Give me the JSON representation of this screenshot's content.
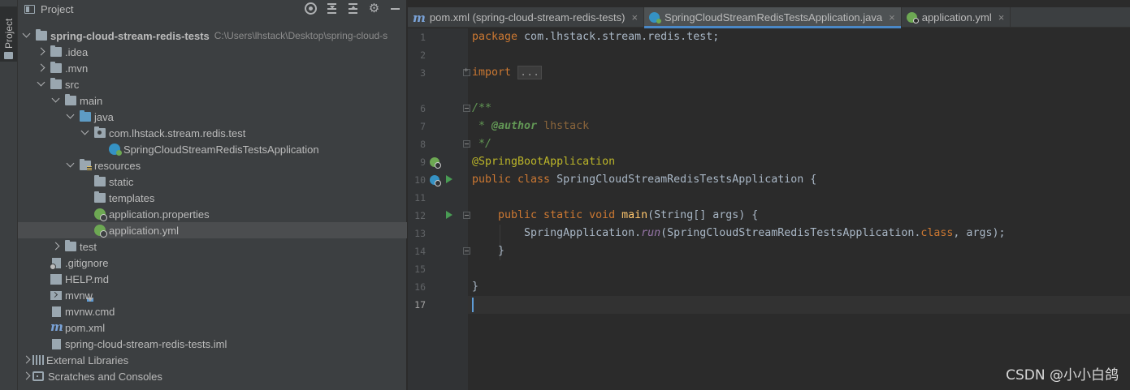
{
  "toolstrip": {
    "project_tab": "Project"
  },
  "project": {
    "title": "Project",
    "header_icons": [
      "locate-icon",
      "expand-all-icon",
      "collapse-all-icon",
      "gear-icon",
      "hide-icon"
    ],
    "tree": [
      {
        "label": "spring-cloud-stream-redis-tests",
        "path": "C:\\Users\\lhstack\\Desktop\\spring-cloud-s",
        "icon": "module-folder-icon",
        "expanded": true
      },
      {
        "label": ".idea",
        "icon": "folder-icon",
        "expanded": false
      },
      {
        "label": ".mvn",
        "icon": "folder-icon",
        "expanded": false
      },
      {
        "label": "src",
        "icon": "folder-icon",
        "expanded": true
      },
      {
        "label": "main",
        "icon": "folder-icon",
        "expanded": true
      },
      {
        "label": "java",
        "icon": "source-folder-icon",
        "expanded": true
      },
      {
        "label": "com.lhstack.stream.redis.test",
        "icon": "package-icon",
        "expanded": true
      },
      {
        "label": "SpringCloudStreamRedisTestsApplication",
        "icon": "spring-boot-class-icon"
      },
      {
        "label": "resources",
        "icon": "resources-folder-icon",
        "expanded": true
      },
      {
        "label": "static",
        "icon": "folder-icon"
      },
      {
        "label": "templates",
        "icon": "folder-icon"
      },
      {
        "label": "application.properties",
        "icon": "spring-config-icon"
      },
      {
        "label": "application.yml",
        "icon": "spring-config-icon",
        "selected": true
      },
      {
        "label": "test",
        "icon": "folder-icon",
        "expanded": false
      },
      {
        "label": ".gitignore",
        "icon": "gitignore-file-icon"
      },
      {
        "label": "HELP.md",
        "icon": "markdown-file-icon"
      },
      {
        "label": "mvnw",
        "icon": "shell-file-icon"
      },
      {
        "label": "mvnw.cmd",
        "icon": "cmd-file-icon"
      },
      {
        "label": "pom.xml",
        "icon": "maven-icon"
      },
      {
        "label": "spring-cloud-stream-redis-tests.iml",
        "icon": "iml-file-icon"
      },
      {
        "label": "External Libraries",
        "icon": "libraries-icon",
        "expanded": false
      },
      {
        "label": "Scratches and Consoles",
        "icon": "scratches-icon",
        "expanded": false
      }
    ]
  },
  "editor": {
    "tabs": [
      {
        "label": "pom.xml (spring-cloud-stream-redis-tests)",
        "icon": "maven-icon",
        "close": "×"
      },
      {
        "label": "SpringCloudStreamRedisTestsApplication.java",
        "icon": "spring-boot-class-icon",
        "close": "×",
        "active": true
      },
      {
        "label": "application.yml",
        "icon": "spring-config-icon",
        "close": "×"
      }
    ],
    "line_numbers": [
      "1",
      "2",
      "3",
      "6",
      "7",
      "8",
      "9",
      "10",
      "11",
      "12",
      "13",
      "14",
      "15",
      "16",
      "17"
    ],
    "code": {
      "l1_kw": "package",
      "l1_rest": " com.lhstack.stream.redis.test;",
      "l3_kw": "import",
      "l3_fold": "...",
      "l6": "/**",
      "l7_star": " * ",
      "l7_tag": "@author",
      "l7_txt": " lhstack",
      "l8": " */",
      "l9": "@SpringBootApplication",
      "l10_kw": "public class",
      "l10_name": " SpringCloudStreamRedisTestsApplication {",
      "l12_kw": "    public static void",
      "l12_fn": " main",
      "l12_rest": "(String[] args) {",
      "l13_cls": "        SpringApplication.",
      "l13_fn": "run",
      "l13_mid": "(SpringCloudStreamRedisTestsApplication.",
      "l13_kw": "class",
      "l13_end": ", args);",
      "l14": "    }",
      "l16": "}"
    }
  },
  "watermark": "CSDN @小小白鸽"
}
